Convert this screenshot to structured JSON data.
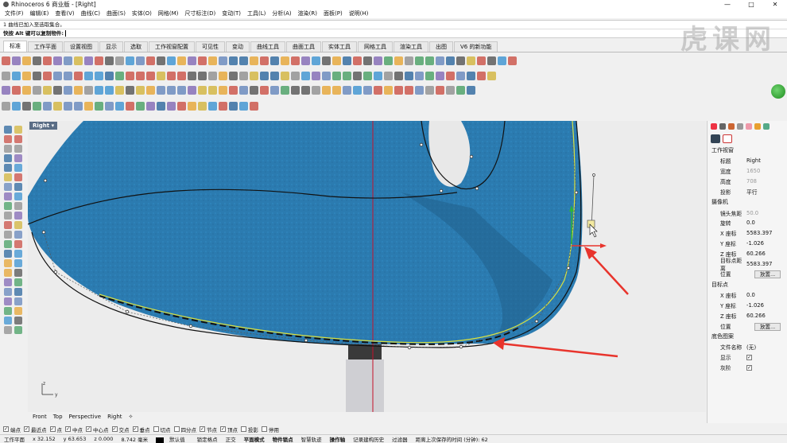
{
  "window": {
    "title": "Rhinoceros 6 商业版 - [Right]",
    "minimize": "—",
    "maximize": "□",
    "close": "✕"
  },
  "menu": [
    "文件(F)",
    "编辑(E)",
    "查看(V)",
    "曲线(C)",
    "曲面(S)",
    "实体(O)",
    "网格(M)",
    "尺寸标注(D)",
    "变动(T)",
    "工具(L)",
    "分析(A)",
    "渲染(R)",
    "面板(P)",
    "说明(H)"
  ],
  "command": {
    "history": "1 曲线已加入至选取集合。",
    "prompt": "快按 Alt 键可以复制物件:"
  },
  "toolbar_tabs": [
    "标准",
    "工作平面",
    "设置视图",
    "显示",
    "选取",
    "工作视窗配置",
    "可见性",
    "变动",
    "曲线工具",
    "曲面工具",
    "实体工具",
    "网格工具",
    "渲染工具",
    "出图",
    "V6 的新功能"
  ],
  "active_tab": "标准",
  "watermark": "虎课网",
  "viewport": {
    "name": "Right",
    "axis_x": "y",
    "axis_y": "z"
  },
  "viewport_tabs": [
    "Front",
    "Top",
    "Perspective",
    "Right",
    "✧"
  ],
  "panel": {
    "section_viewport": "工作视窗",
    "viewport_rows": [
      {
        "k": "标题",
        "v": "Right",
        "disabled": false
      },
      {
        "k": "宽度",
        "v": "1650",
        "disabled": true
      },
      {
        "k": "高度",
        "v": "708",
        "disabled": true
      },
      {
        "k": "投影",
        "v": "平行",
        "disabled": false
      }
    ],
    "section_camera": "摄像机",
    "camera_rows": [
      {
        "k": "镜头焦距",
        "v": "50.0",
        "disabled": true
      },
      {
        "k": "旋转",
        "v": "0.0",
        "disabled": false
      },
      {
        "k": "X 座标",
        "v": "5583.397",
        "disabled": false
      },
      {
        "k": "Y 座标",
        "v": "-1.026",
        "disabled": false
      },
      {
        "k": "Z 座标",
        "v": "60.266",
        "disabled": false
      },
      {
        "k": "目标点距离",
        "v": "5583.397",
        "disabled": false
      }
    ],
    "camera_position_label": "位置",
    "place_button": "放置...",
    "section_target": "目标点",
    "target_rows": [
      {
        "k": "X 座标",
        "v": "0.0",
        "disabled": false
      },
      {
        "k": "Y 座标",
        "v": "-1.026",
        "disabled": false
      },
      {
        "k": "Z 座标",
        "v": "60.266",
        "disabled": false
      }
    ],
    "target_position_label": "位置",
    "section_background": "底色图案",
    "bg_file_label": "文件名称",
    "bg_file_value": "(无)",
    "bg_show_label": "显示",
    "bg_gray_label": "灰阶"
  },
  "osnaps": [
    {
      "label": "端点",
      "checked": true
    },
    {
      "label": "最近点",
      "checked": true
    },
    {
      "label": "点",
      "checked": true
    },
    {
      "label": "中点",
      "checked": true
    },
    {
      "label": "中心点",
      "checked": true
    },
    {
      "label": "交点",
      "checked": true
    },
    {
      "label": "垂点",
      "checked": true
    },
    {
      "label": "切点",
      "checked": false
    },
    {
      "label": "四分点",
      "checked": false
    },
    {
      "label": "节点",
      "checked": true
    },
    {
      "label": "顶点",
      "checked": true
    },
    {
      "label": "投影",
      "checked": false
    },
    {
      "label": "停用",
      "checked": false
    }
  ],
  "status": {
    "cplane": "工作平面",
    "x": "x 32.152",
    "y": "y 63.653",
    "z": "z 0.000",
    "units": "8.742 毫米",
    "layer": "默认值",
    "toggles": [
      "锁定格点",
      "正交",
      "平面模式",
      "物件锁点",
      "智慧轨迹",
      "操作轴",
      "记录建构历史",
      "过滤器"
    ],
    "autosave": "距离上次保存的时间 (分钟): 62"
  },
  "colors": {
    "fabric": "#2b7bb0",
    "accent_red": "#e8342c",
    "curve_yellow": "#d8e040"
  }
}
